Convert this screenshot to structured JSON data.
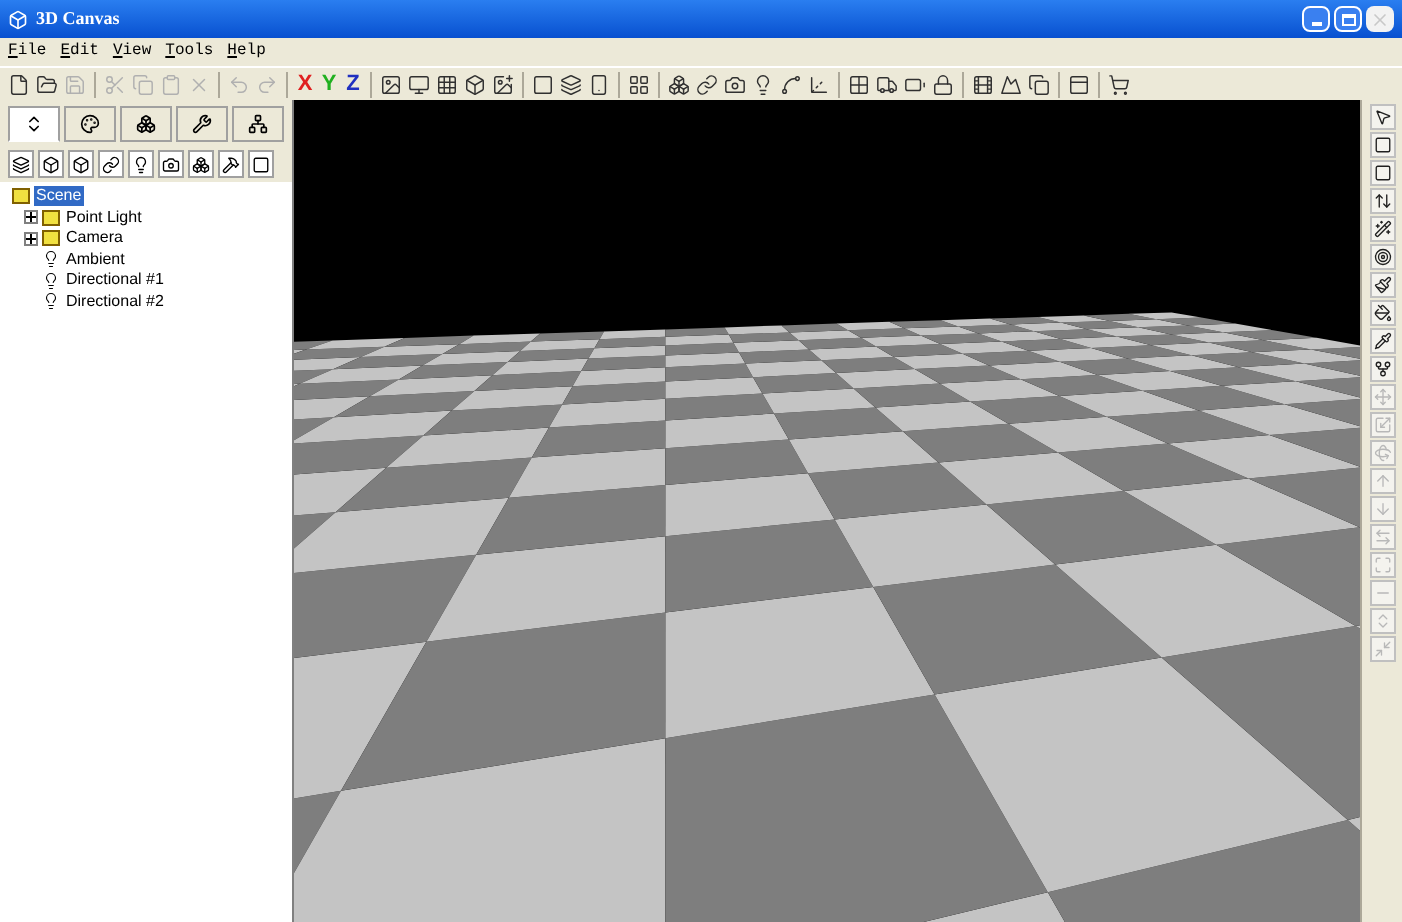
{
  "window": {
    "title": "3D Canvas"
  },
  "menu": [
    "File",
    "Edit",
    "View",
    "Tools",
    "Help"
  ],
  "toolbar": [
    {
      "kind": "icon",
      "disabled": false
    },
    {
      "kind": "icon",
      "disabled": false
    },
    {
      "kind": "icon",
      "disabled": true
    },
    {
      "kind": "sep"
    },
    {
      "kind": "icon",
      "disabled": true
    },
    {
      "kind": "icon",
      "disabled": true
    },
    {
      "kind": "icon",
      "disabled": true
    },
    {
      "kind": "icon",
      "disabled": true
    },
    {
      "kind": "sep"
    },
    {
      "kind": "icon",
      "disabled": true
    },
    {
      "kind": "icon",
      "disabled": true
    },
    {
      "kind": "sep"
    },
    {
      "kind": "text",
      "label": "X",
      "color": "#e02020"
    },
    {
      "kind": "text",
      "label": "Y",
      "color": "#20b020"
    },
    {
      "kind": "text",
      "label": "Z",
      "color": "#2030c0"
    },
    {
      "kind": "sep"
    },
    {
      "kind": "icon",
      "disabled": false
    },
    {
      "kind": "icon",
      "disabled": false
    },
    {
      "kind": "icon",
      "disabled": false
    },
    {
      "kind": "icon",
      "disabled": false
    },
    {
      "kind": "icon",
      "disabled": false
    },
    {
      "kind": "sep"
    },
    {
      "kind": "icon",
      "disabled": false
    },
    {
      "kind": "icon",
      "disabled": false
    },
    {
      "kind": "icon",
      "disabled": false
    },
    {
      "kind": "sep"
    },
    {
      "kind": "icon",
      "disabled": false
    },
    {
      "kind": "sep"
    },
    {
      "kind": "icon",
      "disabled": false
    },
    {
      "kind": "icon",
      "disabled": false
    },
    {
      "kind": "icon",
      "disabled": false
    },
    {
      "kind": "icon",
      "disabled": false
    },
    {
      "kind": "icon",
      "disabled": false
    },
    {
      "kind": "icon",
      "disabled": false
    },
    {
      "kind": "sep"
    },
    {
      "kind": "icon",
      "disabled": false
    },
    {
      "kind": "icon",
      "disabled": false
    },
    {
      "kind": "icon",
      "disabled": false
    },
    {
      "kind": "icon",
      "disabled": false
    },
    {
      "kind": "sep"
    },
    {
      "kind": "icon",
      "disabled": false
    },
    {
      "kind": "icon",
      "disabled": false
    },
    {
      "kind": "icon",
      "disabled": false
    },
    {
      "kind": "sep"
    },
    {
      "kind": "icon",
      "disabled": false
    },
    {
      "kind": "sep"
    },
    {
      "kind": "icon",
      "disabled": false
    }
  ],
  "panel_tabs": [
    {
      "selected": true
    },
    {
      "selected": false
    },
    {
      "selected": false
    },
    {
      "selected": false
    },
    {
      "selected": false
    }
  ],
  "scene_tree": [
    {
      "label": "Scene",
      "selected": true,
      "children": [
        {
          "label": "Point Light",
          "selected": false,
          "expanded": false
        },
        {
          "label": "Camera",
          "selected": false,
          "expanded": false
        },
        {
          "label": "Ambient",
          "selected": false
        },
        {
          "label": "Directional #1",
          "selected": false
        },
        {
          "label": "Directional #2",
          "selected": false
        }
      ]
    }
  ],
  "right_toolbar": [
    {
      "disabled": false
    },
    {
      "disabled": false
    },
    {
      "disabled": false
    },
    {
      "disabled": false
    },
    {
      "disabled": false
    },
    {
      "disabled": false
    },
    {
      "disabled": false
    },
    {
      "disabled": false
    },
    {
      "disabled": false
    },
    {
      "disabled": false
    },
    {
      "disabled": true
    },
    {
      "disabled": true
    },
    {
      "disabled": true
    },
    {
      "disabled": true
    },
    {
      "disabled": true
    },
    {
      "disabled": true
    },
    {
      "disabled": true
    },
    {
      "disabled": true
    },
    {
      "disabled": true
    },
    {
      "disabled": true
    }
  ]
}
